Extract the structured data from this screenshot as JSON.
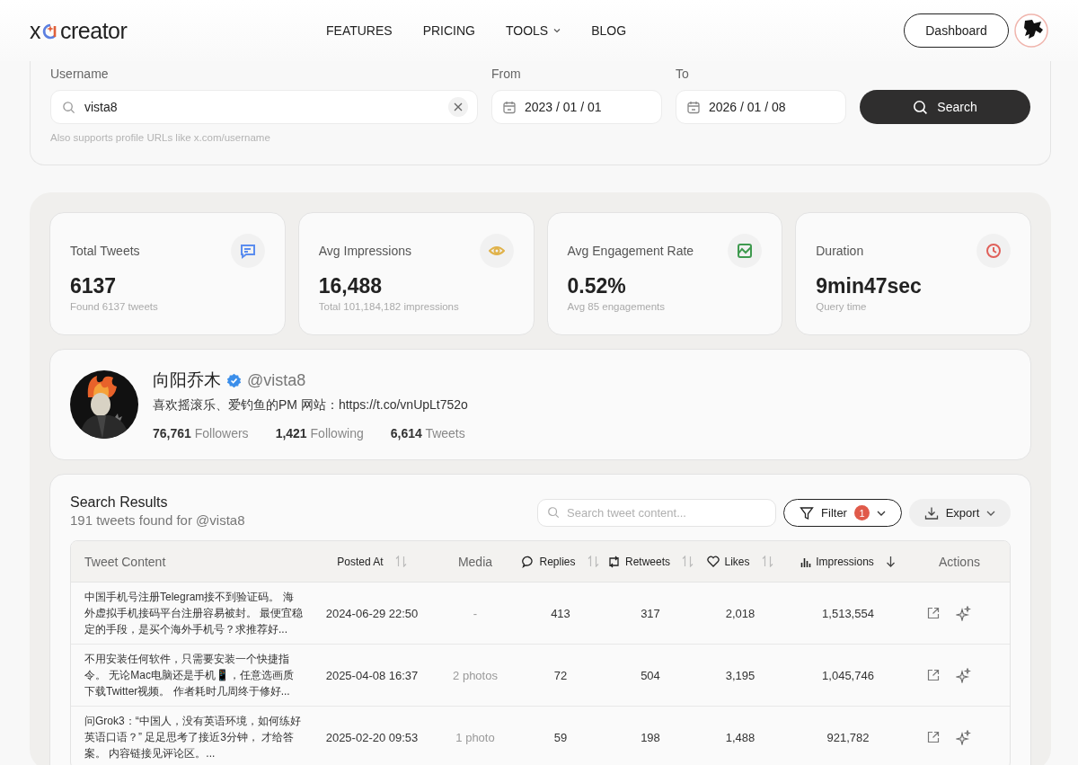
{
  "header": {
    "logo": {
      "left": "x",
      "right": "creator"
    },
    "nav": [
      {
        "label": "FEATURES",
        "dropdown": false
      },
      {
        "label": "PRICING",
        "dropdown": false
      },
      {
        "label": "TOOLS",
        "dropdown": true
      },
      {
        "label": "BLOG",
        "dropdown": false
      }
    ],
    "dashboard_button": "Dashboard"
  },
  "search_form": {
    "username": {
      "label": "Username",
      "value": "vista8",
      "hint": "Also supports profile URLs like x.com/username"
    },
    "from": {
      "label": "From",
      "value": "2023 / 01 / 01"
    },
    "to": {
      "label": "To",
      "value": "2026 / 01 / 08"
    },
    "search_button": "Search"
  },
  "stats": [
    {
      "label": "Total Tweets",
      "value": "6137",
      "sub": "Found 6137 tweets",
      "color": "#5b8def"
    },
    {
      "label": "Avg Impressions",
      "value": "16,488",
      "sub": "Total 101,184,182 impressions",
      "color": "#e0b24a"
    },
    {
      "label": "Avg Engagement Rate",
      "value": "0.52%",
      "sub": "Avg 85 engagements",
      "color": "#3f9a4f"
    },
    {
      "label": "Duration",
      "value": "9min47sec",
      "sub": "Query time",
      "color": "#e0605a"
    }
  ],
  "profile": {
    "name": "向阳乔木",
    "verified": true,
    "handle": "@vista8",
    "bio": "喜欢摇滚乐、爱钓鱼的PM 网站：https://t.co/vnUpLt752o",
    "counts": [
      {
        "value": "76,761",
        "label": "Followers"
      },
      {
        "value": "1,421",
        "label": "Following"
      },
      {
        "value": "6,614",
        "label": "Tweets"
      }
    ]
  },
  "results": {
    "title": "Search Results",
    "subtitle": "191 tweets found for @vista8",
    "search": {
      "placeholder": "Search tweet content..."
    },
    "filter": {
      "label": "Filter",
      "count": "1"
    },
    "export": "Export",
    "columns": [
      {
        "label": "Tweet Content",
        "sortable": false,
        "sorted": false
      },
      {
        "label": "Posted At",
        "sortable": true,
        "sorted": false
      },
      {
        "label": "Media",
        "sortable": false,
        "sorted": false
      },
      {
        "label": "Replies",
        "sortable": true,
        "sorted": false
      },
      {
        "label": "Retweets",
        "sortable": true,
        "sorted": false
      },
      {
        "label": "Likes",
        "sortable": true,
        "sorted": false
      },
      {
        "label": "Impressions",
        "sortable": true,
        "sorted": true
      },
      {
        "label": "Actions",
        "sortable": false,
        "sorted": false
      }
    ],
    "rows": [
      {
        "content": "中国手机号注册Telegram接不到验证码。 海外虚拟手机接码平台注册容易被封。 最便宜稳定的手段，是买个海外手机号？求推荐好...",
        "posted": "2024-06-29 22:50",
        "media": "-",
        "replies": "413",
        "retweets": "317",
        "likes": "2,018",
        "impressions": "1,513,554"
      },
      {
        "content": "不用安装任何软件，只需要安装一个快捷指令。 无论Mac电脑还是手机📱，任意选画质下载Twitter视频。 作者耗时几周终于修好...",
        "posted": "2025-04-08 16:37",
        "media": "2 photos",
        "replies": "72",
        "retweets": "504",
        "likes": "3,195",
        "impressions": "1,045,746"
      },
      {
        "content": "问Grok3：“中国人，没有英语环境，如何练好英语口语？” 足足思考了接近3分钟， 才给答案。 内容链接见评论区。...",
        "posted": "2025-02-20 09:53",
        "media": "1 photo",
        "replies": "59",
        "retweets": "198",
        "likes": "1,488",
        "impressions": "921,782"
      }
    ]
  }
}
